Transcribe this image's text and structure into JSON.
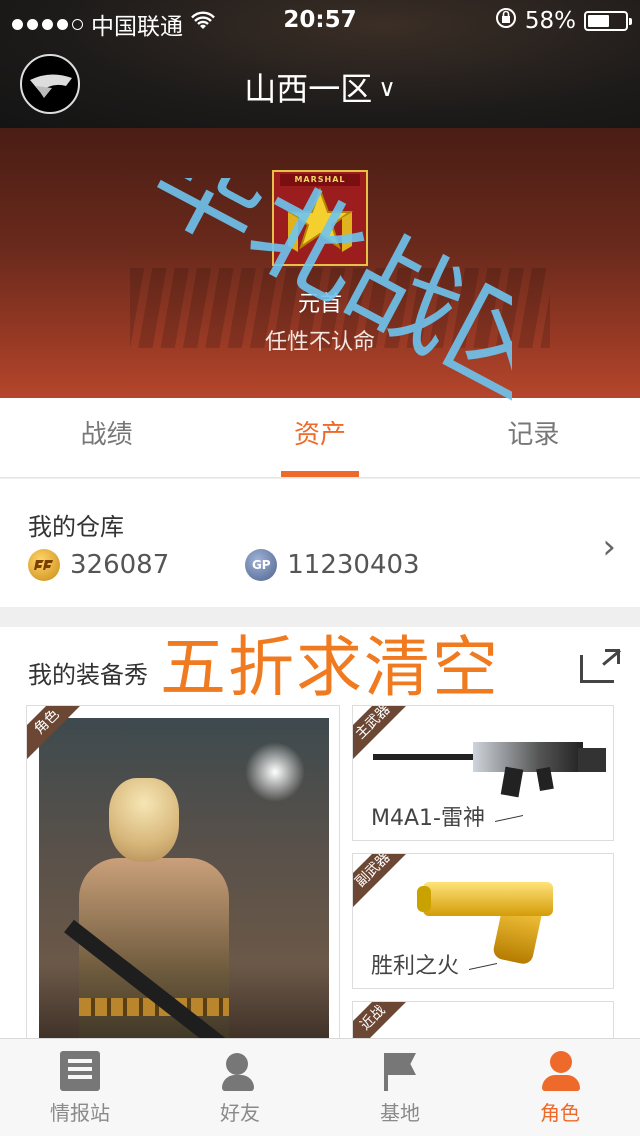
{
  "status_bar": {
    "carrier": "中国联通",
    "time": "20:57",
    "battery": "58%",
    "battery_level": 0.58
  },
  "header": {
    "server_name": "山西一区"
  },
  "profile": {
    "badge_text": "MARSHAL",
    "rank": "元首",
    "nickname": "任性不认命"
  },
  "tabs": [
    {
      "label": "战绩"
    },
    {
      "label": "资产"
    },
    {
      "label": "记录"
    }
  ],
  "warehouse": {
    "title": "我的仓库",
    "cf_points": "326087",
    "gp_points": "11230403",
    "gp_icon_text": "GP"
  },
  "equipment": {
    "title": "我的装备秀",
    "role_tag": "角色",
    "items": [
      {
        "tag": "主武器",
        "name": "M4A1-雷神"
      },
      {
        "tag": "副武器",
        "name": "胜利之火"
      },
      {
        "tag": "近战",
        "name": ""
      }
    ]
  },
  "watermarks": {
    "overlay_1": "华北战区",
    "overlay_2": "五折求清空"
  },
  "tabbar": [
    {
      "label": "情报站",
      "icon": "news-icon"
    },
    {
      "label": "好友",
      "icon": "friends-icon"
    },
    {
      "label": "基地",
      "icon": "flag-icon"
    },
    {
      "label": "角色",
      "icon": "person-icon"
    }
  ],
  "colors": {
    "accent": "#ee6a2b",
    "watermark_blue": "#6ec4ef",
    "watermark_orange": "#f07a1f"
  }
}
